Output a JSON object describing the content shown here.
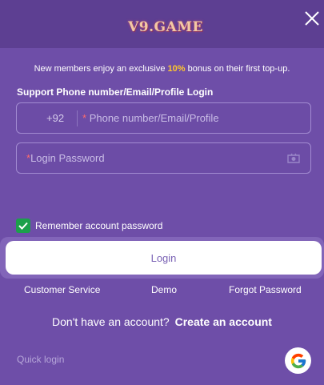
{
  "header": {
    "logo_text": "V9.GAME",
    "close_icon": "close-icon"
  },
  "promo": {
    "prefix": "New members enjoy an exclusive ",
    "highlight": "10%",
    "suffix": " bonus on their first top-up."
  },
  "login_form": {
    "section_label": "Support Phone number/Email/Profile Login",
    "phone": {
      "country_code": "+92",
      "required_mark": "*",
      "placeholder": "Phone number/Email/Profile"
    },
    "password": {
      "required_mark": "*",
      "placeholder": "Login Password",
      "toggle_icon": "eye-icon"
    },
    "remember": {
      "label": "Remember account password",
      "checked": true
    },
    "login_button": "Login"
  },
  "links": {
    "customer_service": "Customer Service",
    "demo": "Demo",
    "forgot_password": "Forgot Password"
  },
  "register": {
    "prompt": "Don't have an account?",
    "create_label": "Create an account"
  },
  "footer": {
    "quick_login": "Quick login",
    "google_icon": "google-icon"
  },
  "colors": {
    "background": "#6e4ea8",
    "header": "#5d3f92",
    "highlight": "#ffc72c",
    "checkbox": "#1ca04b"
  }
}
